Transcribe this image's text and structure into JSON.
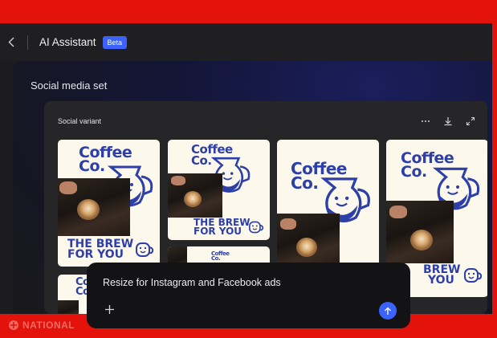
{
  "header": {
    "title": "AI Assistant",
    "badge": "Beta"
  },
  "stage": {
    "title": "Social media set"
  },
  "panel": {
    "title": "Social variant"
  },
  "cards": {
    "brand_line1": "Coffee",
    "brand_line2": "Co.",
    "tagline_line1": "THE BREW",
    "tagline_line2": "FOR YOU",
    "partial_brand_line1": "Coff",
    "partial_brand_line2": "Co.",
    "partial_tagline_line1": "BREW",
    "partial_tagline_line2": "YOU"
  },
  "prompt": {
    "value": "Resize for Instagram and Facebook ads"
  },
  "watermark": {
    "text": "NATIONAL"
  },
  "colors": {
    "accent": "#3b63fb",
    "brand_blue": "#2d3fa8",
    "frame_red": "#e3120b",
    "card_bg": "#fdf8ec"
  }
}
